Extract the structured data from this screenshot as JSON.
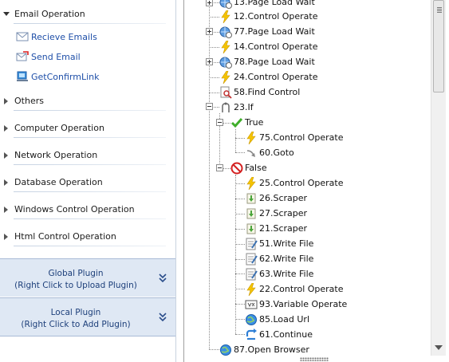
{
  "left_panel": {
    "categories": [
      {
        "label": "Email Operation",
        "expanded": true
      },
      {
        "label": "Others"
      },
      {
        "label": "Computer Operation"
      },
      {
        "label": "Network Operation"
      },
      {
        "label": "Database Operation"
      },
      {
        "label": "Windows Control Operation"
      },
      {
        "label": "Html Control Operation"
      }
    ],
    "email_items": [
      {
        "label": "Recieve Emails",
        "icon": "envelope-icon"
      },
      {
        "label": "Send Email",
        "icon": "send-mail-icon"
      },
      {
        "label": "GetConfirmLink",
        "icon": "link-icon"
      }
    ],
    "global_plugin": {
      "title": "Global Plugin",
      "hint": "(Right Click to Upload Plugin)"
    },
    "local_plugin": {
      "title": "Local Plugin",
      "hint": "(Right Click to Add Plugin)"
    }
  },
  "tree": {
    "nodes": [
      {
        "label": "13.Page Load Wait",
        "icon": "globe-clock-icon",
        "level": 0,
        "expander": "plus"
      },
      {
        "label": "12.Control Operate",
        "icon": "lightning-icon",
        "level": 0
      },
      {
        "label": "77.Page Load Wait",
        "icon": "globe-clock-icon",
        "level": 0,
        "expander": "plus"
      },
      {
        "label": "14.Control Operate",
        "icon": "lightning-icon",
        "level": 0
      },
      {
        "label": "78.Page Load Wait",
        "icon": "globe-clock-icon",
        "level": 0,
        "expander": "plus"
      },
      {
        "label": "24.Control Operate",
        "icon": "lightning-icon",
        "level": 0
      },
      {
        "label": "58.Find Control",
        "icon": "find-control-icon",
        "level": 0
      },
      {
        "label": "23.If",
        "icon": "if-branch-icon",
        "level": 0,
        "expander": "minus"
      },
      {
        "label": "True",
        "icon": "check-icon",
        "level": 1,
        "expander": "minus"
      },
      {
        "label": "75.Control Operate",
        "icon": "lightning-icon",
        "level": 2
      },
      {
        "label": "60.Goto",
        "icon": "goto-arrow-icon",
        "level": 2
      },
      {
        "label": "False",
        "icon": "no-entry-icon",
        "level": 1,
        "expander": "minus"
      },
      {
        "label": "25.Control Operate",
        "icon": "lightning-icon",
        "level": 2
      },
      {
        "label": "26.Scraper",
        "icon": "scraper-icon",
        "level": 2
      },
      {
        "label": "27.Scraper",
        "icon": "scraper-icon",
        "level": 2
      },
      {
        "label": "21.Scraper",
        "icon": "scraper-icon",
        "level": 2
      },
      {
        "label": "51.Write File",
        "icon": "write-file-icon",
        "level": 2
      },
      {
        "label": "62.Write File",
        "icon": "write-file-icon",
        "level": 2
      },
      {
        "label": "63.Write File",
        "icon": "write-file-icon",
        "level": 2
      },
      {
        "label": "22.Control Operate",
        "icon": "lightning-icon",
        "level": 2
      },
      {
        "label": "93.Variable Operate",
        "icon": "variable-icon",
        "level": 2
      },
      {
        "label": "85.Load Url",
        "icon": "globe-icon",
        "level": 2
      },
      {
        "label": "61.Continue",
        "icon": "continue-icon",
        "level": 2
      },
      {
        "label": "87.Open Browser",
        "icon": "globe-icon",
        "level": 0
      }
    ]
  },
  "colors": {
    "link_blue": "#1f4fa8",
    "plugin_bg": "#dfe8f4",
    "lightning": "#f5c400"
  }
}
